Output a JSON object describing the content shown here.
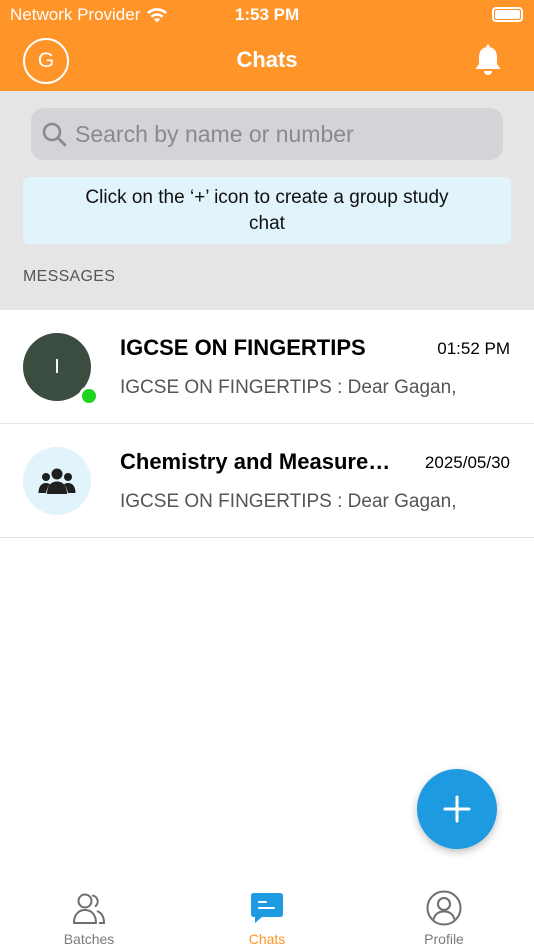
{
  "status_bar": {
    "carrier": "Network Provider",
    "time": "1:53 PM"
  },
  "header": {
    "avatar_initial": "G",
    "title": "Chats"
  },
  "search": {
    "placeholder": "Search by name or number"
  },
  "info_banner": "Click on the ‘+’ icon to create a group study chat",
  "section_label": "MESSAGES",
  "chats": [
    {
      "initial": "I",
      "name": "IGCSE ON FINGERTIPS",
      "time": "01:52 PM",
      "preview": "IGCSE ON FINGERTIPS : Dear Gagan,",
      "online": true
    },
    {
      "icon": "group-icon",
      "name": "Chemistry and Measurements",
      "time": "2025/05/30",
      "preview": "IGCSE ON FINGERTIPS : Dear Gagan,"
    }
  ],
  "tabs": [
    {
      "label": "Batches",
      "icon": "batches-icon"
    },
    {
      "label": "Chats",
      "icon": "chats-icon",
      "active": true
    },
    {
      "label": "Profile",
      "icon": "profile-icon"
    }
  ],
  "colors": {
    "header": "#FF9428",
    "accent": "#FF9428",
    "fab": "#1E9BE0",
    "online": "#1BD41B",
    "info_bg": "#E1F3FB"
  }
}
